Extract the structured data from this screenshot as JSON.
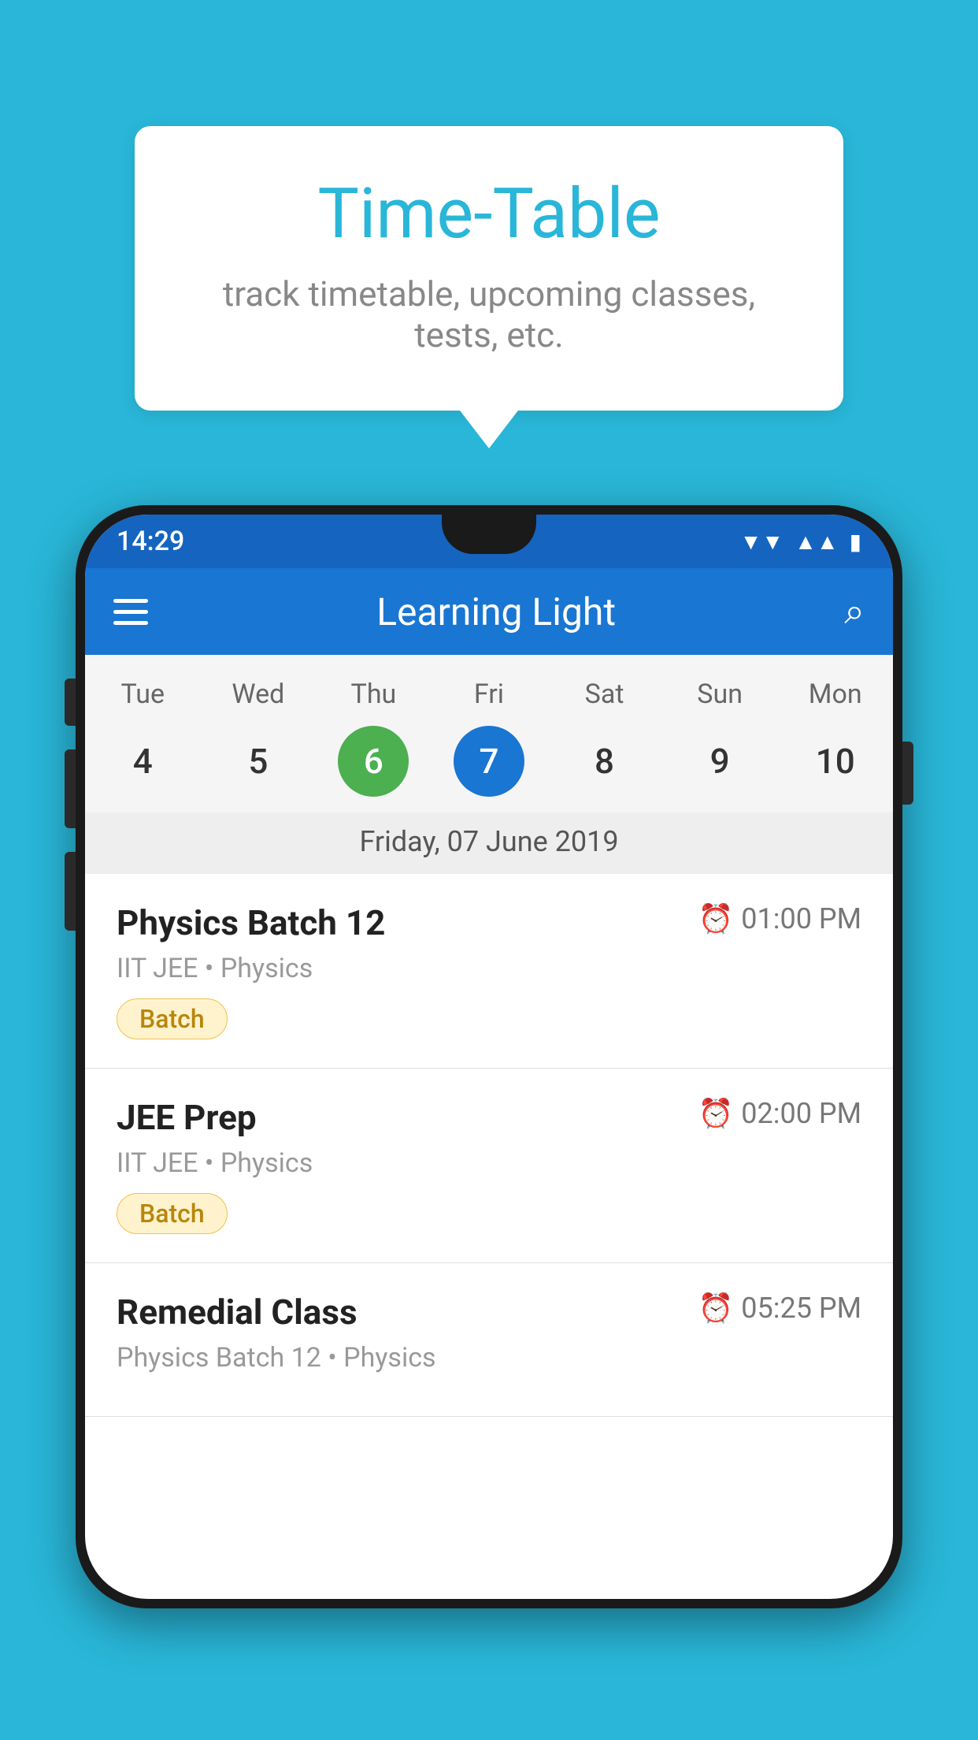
{
  "background_color": "#29B6D8",
  "tooltip": {
    "title": "Time-Table",
    "subtitle": "track timetable, upcoming classes, tests, etc."
  },
  "phone": {
    "status_bar": {
      "time": "14:29"
    },
    "app_bar": {
      "title": "Learning Light"
    },
    "calendar": {
      "days": [
        {
          "label": "Tue",
          "number": "4"
        },
        {
          "label": "Wed",
          "number": "5"
        },
        {
          "label": "Thu",
          "number": "6",
          "state": "today"
        },
        {
          "label": "Fri",
          "number": "7",
          "state": "selected"
        },
        {
          "label": "Sat",
          "number": "8"
        },
        {
          "label": "Sun",
          "number": "9"
        },
        {
          "label": "Mon",
          "number": "10"
        }
      ],
      "selected_date_label": "Friday, 07 June 2019"
    },
    "events": [
      {
        "name": "Physics Batch 12",
        "time": "01:00 PM",
        "meta": "IIT JEE • Physics",
        "badge": "Batch"
      },
      {
        "name": "JEE Prep",
        "time": "02:00 PM",
        "meta": "IIT JEE • Physics",
        "badge": "Batch"
      },
      {
        "name": "Remedial Class",
        "time": "05:25 PM",
        "meta": "Physics Batch 12 • Physics",
        "badge": ""
      }
    ]
  }
}
